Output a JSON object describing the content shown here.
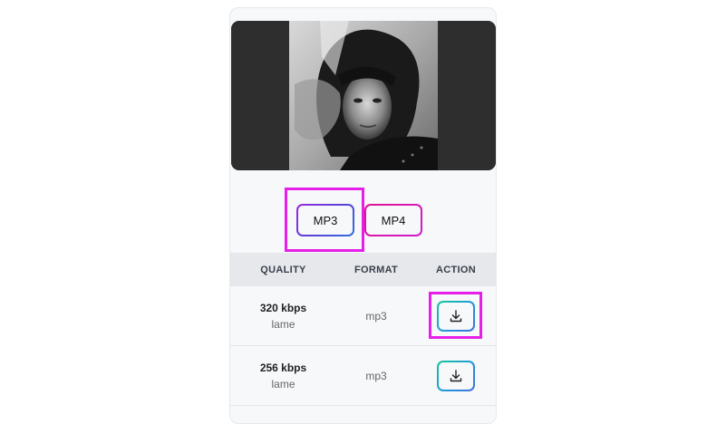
{
  "video": {
    "thumbnail_alt": "video-thumbnail"
  },
  "formats": {
    "options": [
      "MP3",
      "MP4"
    ],
    "selected": "MP3"
  },
  "table": {
    "headers": {
      "quality": "QUALITY",
      "format": "FORMAT",
      "action": "ACTION"
    },
    "rows": [
      {
        "quality": "320 kbps",
        "codec": "lame",
        "format": "mp3",
        "action_icon": "download-icon"
      },
      {
        "quality": "256 kbps",
        "codec": "lame",
        "format": "mp3",
        "action_icon": "download-icon"
      }
    ]
  },
  "colors": {
    "highlight": "#e51ee8",
    "mp3_border": "#5a3fd8",
    "mp4_border": "#e0148f",
    "download_border": "#1f9bd8"
  }
}
